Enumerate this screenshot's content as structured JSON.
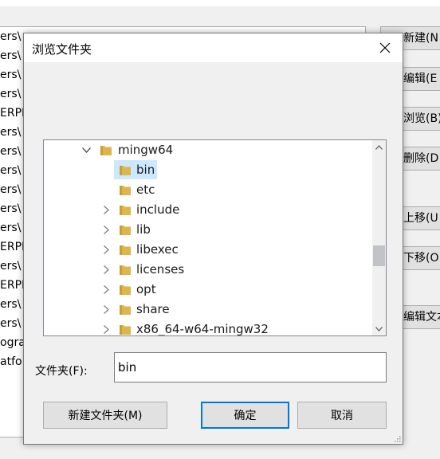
{
  "background_window": {
    "list_rows": [
      "ers\\",
      "ers\\",
      "ers\\",
      "ers\\",
      "ERPR",
      "ers\\",
      "ers\\",
      "ers\\",
      "ers\\",
      "ers\\",
      "ers\\",
      "ERPR",
      "ers\\",
      "ERPR",
      "ers\\",
      "ers\\",
      "ogra",
      "atfo"
    ],
    "buttons": [
      {
        "label": "新建(N"
      },
      {
        "label": "编辑(E"
      },
      {
        "label": "浏览(B)"
      },
      {
        "label": "删除(D"
      },
      {
        "label": "上移(U"
      },
      {
        "label": "下移(O"
      },
      {
        "label": "编辑文本("
      }
    ]
  },
  "dialog": {
    "title": "浏览文件夹",
    "tree": {
      "items": [
        {
          "label": "mingw64",
          "expanded": true,
          "has_children": true
        },
        {
          "label": "bin",
          "selected": true,
          "has_children": false
        },
        {
          "label": "etc",
          "has_children": false
        },
        {
          "label": "include",
          "has_children": true
        },
        {
          "label": "lib",
          "has_children": true
        },
        {
          "label": "libexec",
          "has_children": true
        },
        {
          "label": "licenses",
          "has_children": true
        },
        {
          "label": "opt",
          "has_children": true
        },
        {
          "label": "share",
          "has_children": true
        },
        {
          "label": "x86_64-w64-mingw32",
          "has_children": true
        }
      ]
    },
    "folder_field_label": "文件夹(F):",
    "folder_field_value": "bin",
    "buttons": {
      "new_folder": "新建文件夹(M)",
      "ok": "确定",
      "cancel": "取消"
    }
  },
  "colors": {
    "folder": "#dcb64b",
    "folder_dark": "#c99f2e",
    "selection": "#cce8ff",
    "default_button_border": "#0078d7"
  },
  "icons": {
    "close": "close-icon",
    "expand": "chevron-right-icon",
    "collapse": "chevron-down-icon",
    "folder": "folder-icon"
  }
}
